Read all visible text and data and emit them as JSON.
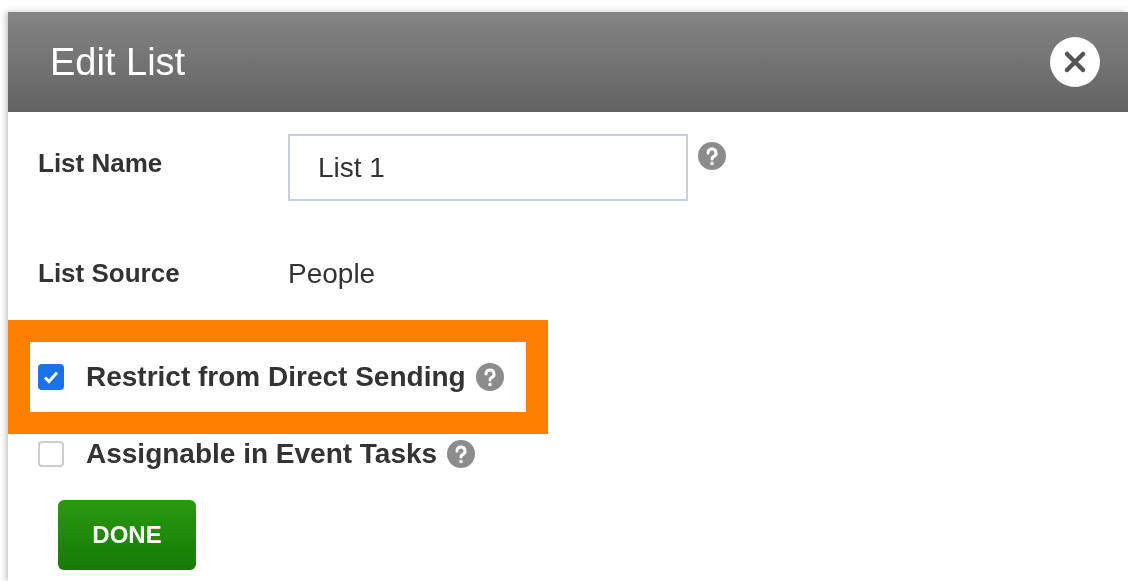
{
  "dialog": {
    "title": "Edit List"
  },
  "fields": [
    {
      "kind": "input",
      "label": "List Name",
      "value": "List 1",
      "help": true
    },
    {
      "kind": "text",
      "label": "List Source",
      "value": "People",
      "help": false
    }
  ],
  "options": [
    {
      "label": "Restrict from Direct Sending",
      "checked": true,
      "highlighted": true,
      "help": true
    },
    {
      "label": "Assignable in Event Tasks",
      "checked": false,
      "highlighted": false,
      "help": true
    }
  ],
  "buttons": [
    {
      "label": "DONE"
    }
  ]
}
